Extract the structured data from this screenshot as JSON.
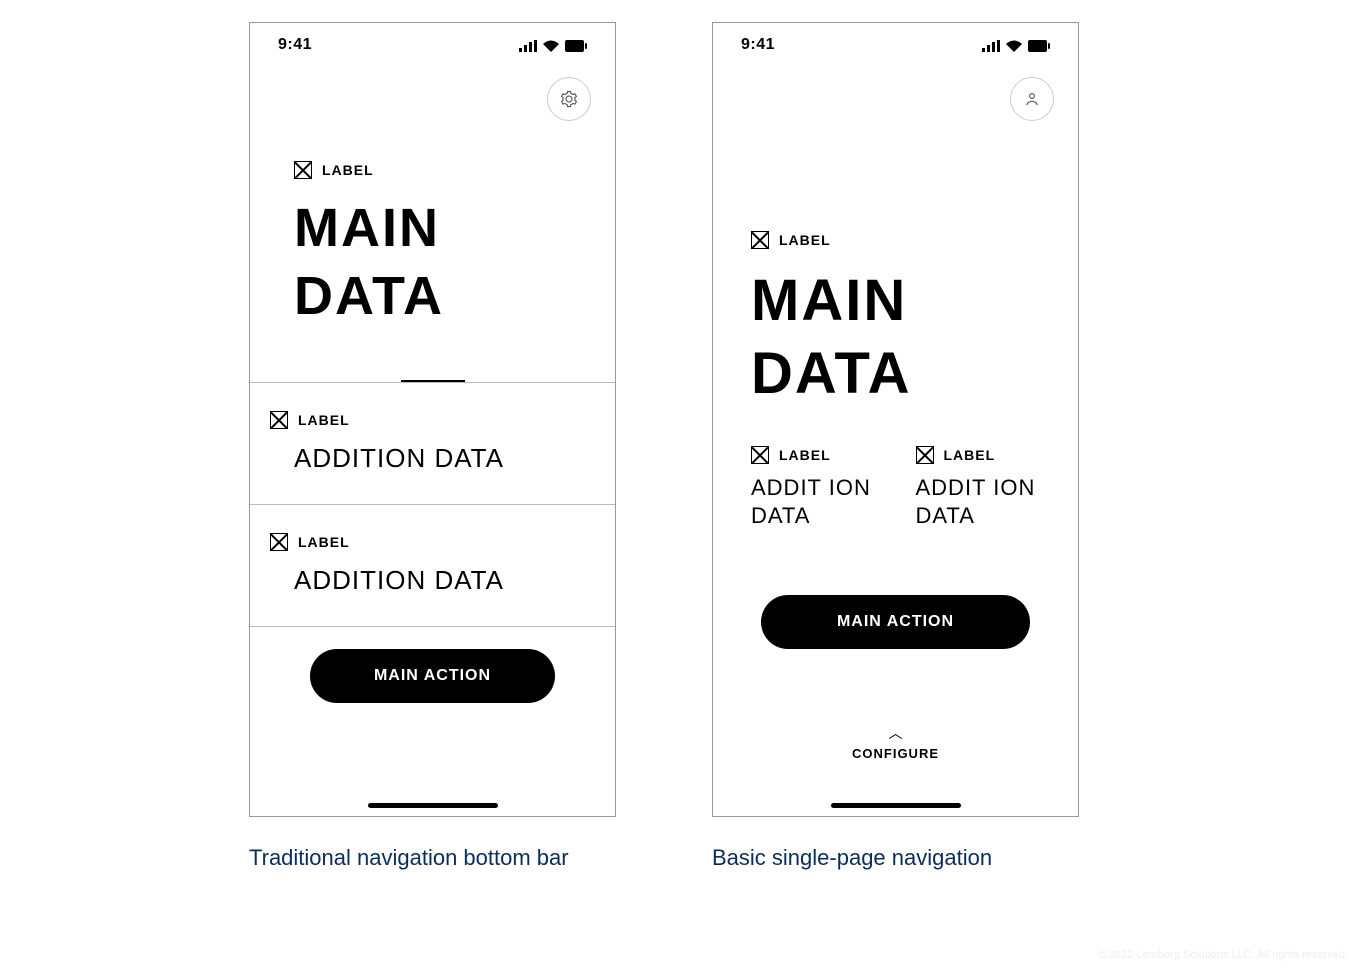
{
  "status": {
    "time": "9:41"
  },
  "phone_left": {
    "topicon": "settings-icon",
    "section_main": {
      "label": "LABEL",
      "title": "MAIN DATA"
    },
    "cards": [
      {
        "label": "LABEL",
        "title": "ADDITION DATA"
      },
      {
        "label": "LABEL",
        "title": "ADDITION DATA"
      }
    ],
    "main_action": "MAIN ACTION"
  },
  "phone_right": {
    "topicon": "person-icon",
    "section_main": {
      "label": "LABEL",
      "title": "MAIN DATA"
    },
    "columns": [
      {
        "label": "LABEL",
        "title": "ADDIT ION DATA"
      },
      {
        "label": "LABEL",
        "title": "ADDIT ION DATA"
      }
    ],
    "main_action": "MAIN ACTION",
    "configure": "CONFIGURE"
  },
  "captions": {
    "left": "Traditional navigation bottom bar",
    "right": "Basic single-page navigation"
  },
  "footer": "© 2022 Lemberg Solutions LLC. All rights reserved."
}
